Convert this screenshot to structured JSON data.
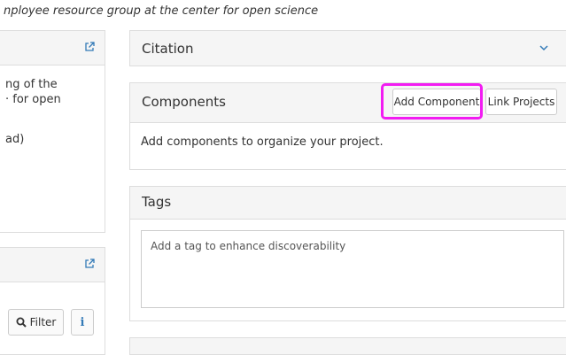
{
  "header": {
    "subtitle": "nployee resource group at the center for open science"
  },
  "left": {
    "panel1": {
      "text_line1": "ng of the",
      "text_line2": "· for open",
      "text_line3": "ad)"
    },
    "panel2": {
      "filter_label": "Filter",
      "info_label": "i"
    }
  },
  "citation": {
    "title": "Citation"
  },
  "components": {
    "title": "Components",
    "add_component_label": "Add Component",
    "link_projects_label": "Link Projects",
    "body": "Add components to organize your project."
  },
  "tags": {
    "title": "Tags",
    "placeholder": "Add a tag to enhance discoverability"
  },
  "colors": {
    "highlight": "#f21cf2",
    "link": "#337ab7"
  },
  "icons": [
    "external-link-icon",
    "chevron-down-icon",
    "search-icon",
    "info-icon"
  ]
}
